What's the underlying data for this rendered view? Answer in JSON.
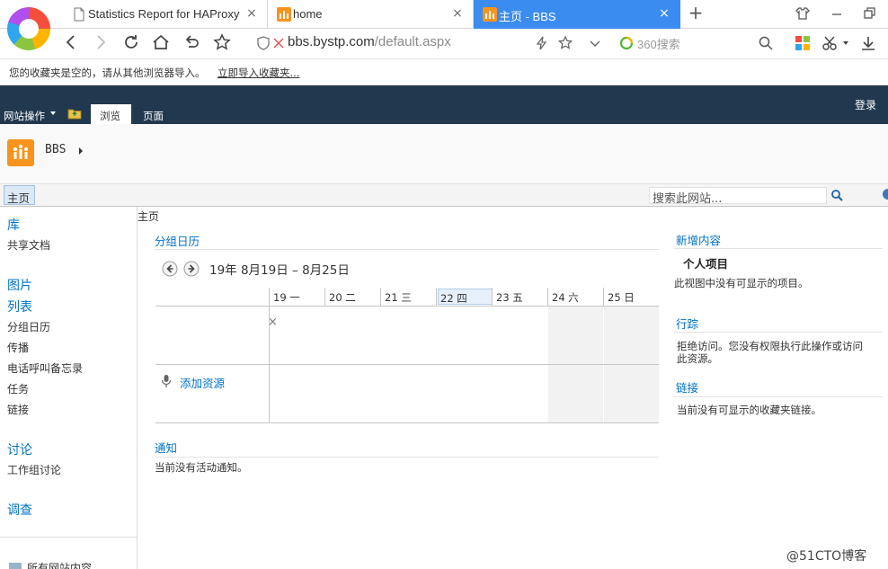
{
  "browser": {
    "tabs": [
      {
        "title": "Statistics Report for HAProxy",
        "close": "×"
      },
      {
        "title": "home",
        "close": "×"
      },
      {
        "title": "主页 - BBS",
        "close": "×"
      }
    ],
    "new_tab": "+",
    "url": {
      "host": "bbs.bystp.com",
      "path": "/default.aspx"
    },
    "search_placeholder": "360搜索",
    "favbar": {
      "message": "您的收藏夹是空的，请从其他浏览器导入。",
      "import_link": "立即导入收藏夹..."
    }
  },
  "ribbon": {
    "site_actions": "网站操作",
    "tab_browse": "浏览",
    "tab_page": "页面",
    "login": "登录"
  },
  "site": {
    "name": "BBS"
  },
  "topnav": {
    "home": "主页",
    "search_placeholder": "搜索此网站..."
  },
  "quick_launch": [
    {
      "heading": "库",
      "items": [
        "共享文档"
      ]
    },
    {
      "heading": "图片",
      "items": []
    },
    {
      "heading": "列表",
      "items": [
        "分组日历",
        "传播",
        "电话呼叫备忘录",
        "任务",
        "链接"
      ]
    },
    {
      "heading": "讨论",
      "items": [
        "工作组讨论"
      ]
    },
    {
      "heading": "调查",
      "items": []
    }
  ],
  "quick_launch_footer": "所有网站内容",
  "breadcrumb": "主页",
  "calendar": {
    "title": "分组日历",
    "date_range": "19年 8月19日 – 8月25日",
    "days": [
      "19 一",
      "20 二",
      "21 三",
      "22 四",
      "23 五",
      "24 六",
      "25 日"
    ],
    "today_index": 3,
    "delete_mark": "×",
    "add_resource": "添加资源"
  },
  "announcements": {
    "title": "通知",
    "empty": "当前没有活动通知。"
  },
  "right": {
    "whats_new": {
      "title": "新增内容",
      "subtitle": "个人项目",
      "empty": "此视图中没有可显示的项目。"
    },
    "tracking": {
      "title": "行踪",
      "line1": "拒绝访问。您没有权限执行此操作或访问",
      "line2": "此资源。"
    },
    "links": {
      "title": "链接",
      "empty": "当前没有可显示的收藏夹链接。"
    }
  },
  "watermark": "@51CTO博客",
  "colors": {
    "ribbon": "#21384f",
    "active_tab": "#3b8cf0",
    "link": "#0072c6",
    "sp_orange": "#f7941d"
  }
}
